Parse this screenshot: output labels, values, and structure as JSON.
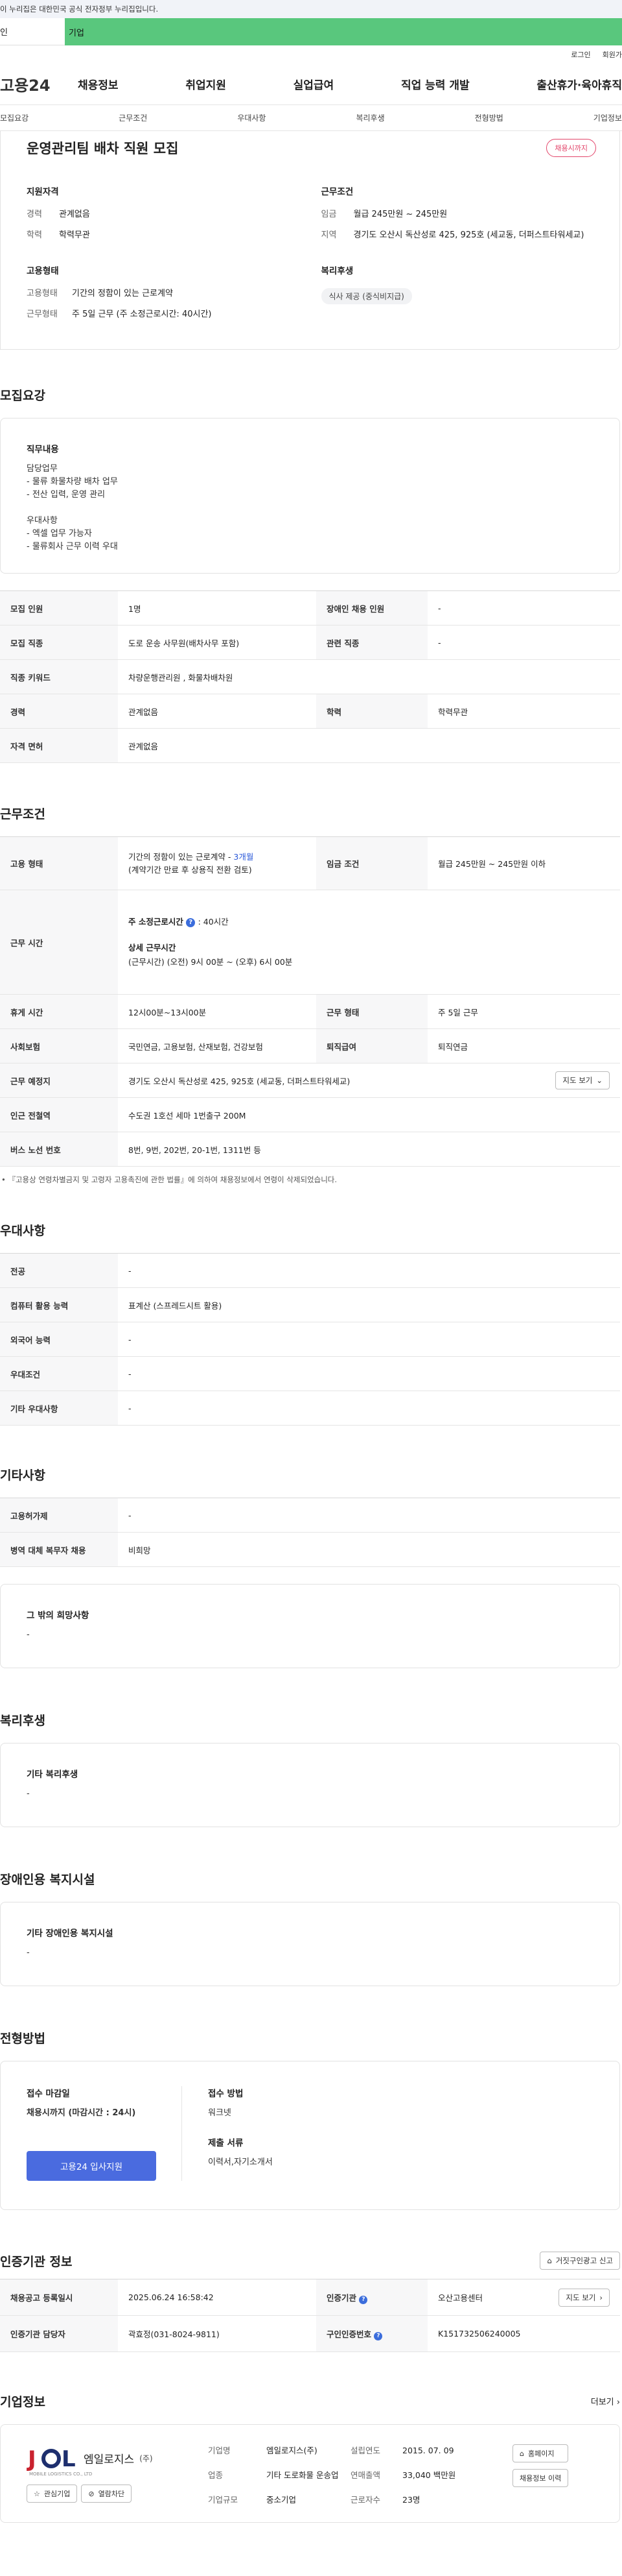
{
  "topbar": {
    "notice": "이 누리집은 대한민국 공식 전자정부 누리집입니다."
  },
  "tabs": {
    "first": "인",
    "second": "기업"
  },
  "util": {
    "login": "로그인",
    "join": "회원가"
  },
  "gnb": {
    "logo": "고용24",
    "menu": [
      "채용정보",
      "취업지원",
      "실업급여",
      "직업 능력 개발",
      "출산휴가·육아휴직"
    ]
  },
  "anchor": [
    "모집요강",
    "근무조건",
    "우대사항",
    "복리후생",
    "전형방법",
    "기업정보"
  ],
  "summary": {
    "title": "운영관리팀 배차 직원 모집",
    "badge": "채용시까지",
    "qual_title": "지원자격",
    "career_k": "경력",
    "career_v": "관계없음",
    "edu_k": "학력",
    "edu_v": "학력무관",
    "emp_title": "고용형태",
    "emp_k1": "고용형태",
    "emp_v1": "기간의 정함이 있는 근로계약",
    "emp_k2": "근무형태",
    "emp_v2": "주 5일 근무 (주 소정근로시간: 40시간)",
    "cond_title": "근무조건",
    "wage_k": "임금",
    "wage_v": "월급 245만원 ~ 245만원",
    "area_k": "지역",
    "area_v": "경기도 오산시 독산성로 425, 925호 (세교동, 더퍼스트타워세교)",
    "welfare_title": "복리후생",
    "welfare_chip": "식사 제공 (중식비지급)"
  },
  "recruit": {
    "section": "모집요강",
    "duty_title": "직무내용",
    "duty_text": [
      "담당업무",
      "- 물류 화물차량 배차 업무",
      "- 전산 입력, 운영 관리",
      "",
      "우대사항",
      "- 엑셀 업무 가능자",
      "- 물류회사 근무 이력 우대"
    ],
    "rows": {
      "r1k": "모집 인원",
      "r1v": "1명",
      "r1k2": "장애인 채용 인원",
      "r1v2": "-",
      "r2k": "모집 직종",
      "r2v": "도로 운송 사무원(배차사무 포함)",
      "r2k2": "관련 직종",
      "r2v2": "-",
      "r3k": "직종 키워드",
      "r3v": "차량운행관리원 , 화물차배차원",
      "r4k": "경력",
      "r4v": "관계없음",
      "r4k2": "학력",
      "r4v2": "학력무관",
      "r5k": "자격 면허",
      "r5v": "관계없음"
    }
  },
  "work": {
    "section": "근무조건",
    "emp_k": "고용 형태",
    "emp_v1": "기간의 정함이 있는 근로계약 - ",
    "emp_v1b": "3개월",
    "emp_v2": "(계약기간 만료 후 상용직 전환 검토)",
    "wage_k": "임금 조건",
    "wage_v": "월급 245만원 ~ 245만원 이하",
    "time_k": "근무 시간",
    "time_a": "주 소정근로시간",
    "time_a2": ": 40시간",
    "time_b": "상세 근무시간",
    "time_c": "(근무시간) (오전) 9시 00분 ~ (오후) 6시 00분",
    "rest_k": "휴게 시간",
    "rest_v": "12시00분~13시00분",
    "form_k": "근무 형태",
    "form_v": "주 5일 근무",
    "ins_k": "사회보험",
    "ins_v": "국민연금, 고용보험, 산재보험, 건강보험",
    "ret_k": "퇴직급여",
    "ret_v": "퇴직연금",
    "place_k": "근무 예정지",
    "place_v": "경기도 오산시 독산성로 425, 925호 (세교동, 더퍼스트타워세교)",
    "map_btn": "지도 보기",
    "subway_k": "인근 전철역",
    "subway_v": "수도권 1호선 세마 1번출구 200M",
    "bus_k": "버스 노선 번호",
    "bus_v": "8번, 9번, 202번, 20-1번, 1311번 등",
    "note": "• 『고용상 연령차별금지 및 고령자 고용촉진에 관한 법률』에 의하여 채용정보에서 연령이 삭제되었습니다."
  },
  "pref": {
    "section": "우대사항",
    "r1k": "전공",
    "r1v": "-",
    "r2k": "컴퓨터 활용 능력",
    "r2v": "표계산 (스프레드시트 활용)",
    "r3k": "외국어 능력",
    "r3v": "-",
    "r4k": "우대조건",
    "r4v": "-",
    "r5k": "기타 우대사항",
    "r5v": "-"
  },
  "etc": {
    "section": "기타사항",
    "r1k": "고용허가제",
    "r1v": "-",
    "r2k": "병역 대체 복무자 채용",
    "r2v": "비희망",
    "box_title": "그 밖의 희망사항",
    "box_v": "-"
  },
  "welfare": {
    "section": "복리후생",
    "box_title": "기타 복리후생",
    "box_v": "-"
  },
  "disabled": {
    "section": "장애인용 복지시설",
    "box_title": "기타 장애인용 복지시설",
    "box_v": "-"
  },
  "apply": {
    "section": "전형방법",
    "deadline_t": "접수 마감일",
    "deadline_v": "채용시까지 (마감시간 : 24시)",
    "method_t": "접수 방법",
    "method_v": "워크넷",
    "docs_t": "제출 서류",
    "docs_v": "이력서,자기소개서",
    "apply_btn": "고용24 입사지원"
  },
  "auth": {
    "section": "인증기관 정보",
    "report_btn": "거짓구인광고 신고",
    "r1k": "채용공고 등록일시",
    "r1v": "2025.06.24 16:58:42",
    "r1k2": "인증기관",
    "r1v2": "오산고용센터",
    "map_btn": "지도 보기",
    "r2k": "인증기관 담당자",
    "r2v": "곽효정(031-8024-9811)",
    "r2k2": "구인인증번호",
    "r2v2": "K151732506240005"
  },
  "corp": {
    "section": "기업정보",
    "more": "더보기",
    "logo_text": "엠일로지스",
    "logo_sub": "(주)",
    "logo_small": "MOBILE LOGISTICS CO., LTD",
    "fav_btn": "관심기업",
    "block_btn": "열람차단",
    "k1": "기업명",
    "v1": "엠일로지스(주)",
    "k2": "설립연도",
    "v2": "2015. 07. 09",
    "k3": "업종",
    "v3": "기타 도로화물 운송업",
    "k4": "연매출액",
    "v4": "33,040 백만원",
    "k5": "근로자수",
    "v5": "23명",
    "k6": "기업규모",
    "v6": "중소기업",
    "home_btn": "홈페이지",
    "history_btn": "채용정보 이력"
  }
}
